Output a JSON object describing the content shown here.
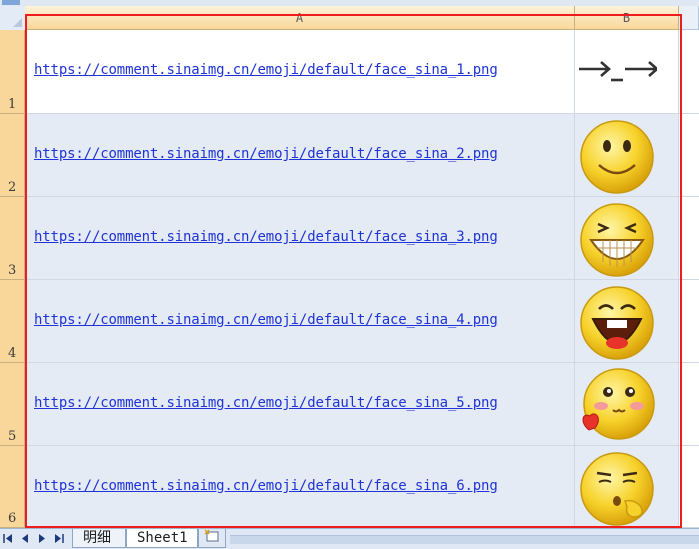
{
  "columns": {
    "a": "A",
    "b": "B"
  },
  "rows": [
    {
      "num": "1",
      "url": "https://comment.sinaimg.cn/emoji/default/face_sina_1.png",
      "emoji": "arrow-face-icon"
    },
    {
      "num": "2",
      "url": "https://comment.sinaimg.cn/emoji/default/face_sina_2.png",
      "emoji": "smile-face-icon"
    },
    {
      "num": "3",
      "url": "https://comment.sinaimg.cn/emoji/default/face_sina_3.png",
      "emoji": "grin-face-icon"
    },
    {
      "num": "4",
      "url": "https://comment.sinaimg.cn/emoji/default/face_sina_4.png",
      "emoji": "laugh-face-icon"
    },
    {
      "num": "5",
      "url": "https://comment.sinaimg.cn/emoji/default/face_sina_5.png",
      "emoji": "love-face-icon"
    },
    {
      "num": "6",
      "url": "https://comment.sinaimg.cn/emoji/default/face_sina_6.png",
      "emoji": "shush-face-icon"
    }
  ],
  "sheet_tabs": [
    "明细",
    "Sheet1"
  ],
  "colors": {
    "selection": "#ee1c1c",
    "link": "#1f33d6",
    "header": "#f9d79a",
    "cell": "#e5ebf5"
  }
}
